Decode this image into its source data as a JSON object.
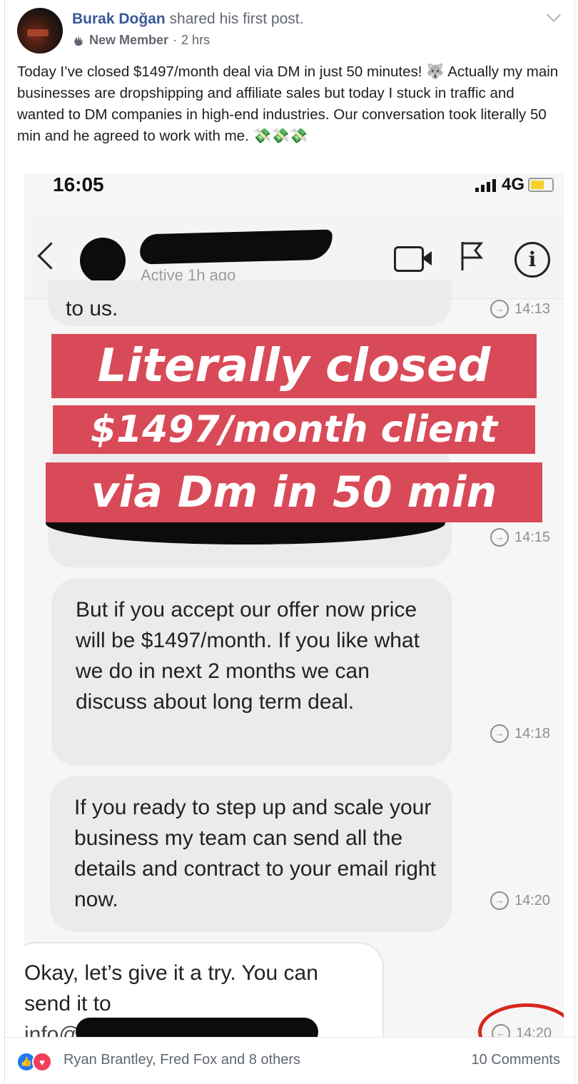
{
  "post": {
    "author": "Burak Doğan",
    "action": "shared his first post.",
    "badge": "New Member",
    "time": "2 hrs",
    "text": "Today I’ve closed $1497/month deal via DM in just 50 minutes! 🐺 Actually my main businesses are dropshipping and affiliate sales but today I stuck in traffic and wanted to DM companies in high-end industries. Our conversation took literally 50 min and he agreed to work with me. 💸💸💸"
  },
  "screenshot": {
    "status_time": "16:05",
    "network": "4G",
    "active_status": "Active 1h ago",
    "messages": [
      {
        "text": "to us.",
        "time": "14:13"
      },
      {
        "text": "",
        "time": "14:15"
      },
      {
        "text": "But if you accept our offer now price will be $1497/month. If you like what we do in next 2 months we can discuss about long term deal.",
        "time": "14:18"
      },
      {
        "text": "If you ready to step up and scale your business my team can send all the details and contract to your email right now.",
        "time": "14:20"
      },
      {
        "text": "Okay, let’s give it a try. You can send it to",
        "time": "14:20"
      }
    ],
    "reply_partial": "info@",
    "banner": [
      "Literally closed",
      "$1497/month client",
      "via Dm in 50 min"
    ]
  },
  "footer": {
    "reactions": "Ryan Brantley, Fred Fox and 8 others",
    "comments": "10 Comments"
  },
  "colors": {
    "link": "#385898",
    "banner": "#d94a58",
    "like": "#2078f4",
    "love": "#f33e58"
  }
}
